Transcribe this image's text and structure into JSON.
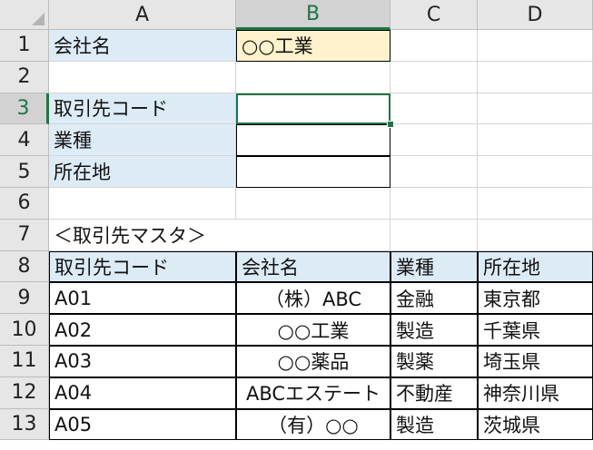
{
  "columns": [
    "A",
    "B",
    "C",
    "D"
  ],
  "selected_column": "B",
  "rows": [
    "1",
    "2",
    "3",
    "4",
    "5",
    "6",
    "7",
    "8",
    "9",
    "10",
    "11",
    "12",
    "13"
  ],
  "selected_row": "3",
  "cells": {
    "A1": "会社名",
    "B1": "○○工業",
    "A3": "取引先コード",
    "A4": "業種",
    "A5": "所在地",
    "A7": "＜取引先マスタ＞",
    "A8": "取引先コード",
    "B8": "会社名",
    "C8": "業種",
    "D8": "所在地",
    "A9": "A01",
    "B9": "（株）ABC",
    "C9": "金融",
    "D9": "東京都",
    "A10": "A02",
    "B10": "○○工業",
    "C10": "製造",
    "D10": "千葉県",
    "A11": "A03",
    "B11": "○○薬品",
    "C11": "製薬",
    "D11": "埼玉県",
    "A12": "A04",
    "B12": "ABCエステート",
    "C12": "不動産",
    "D12": "神奈川県",
    "A13": "A05",
    "B13": "（有）○○",
    "C13": "製造",
    "D13": "茨城県"
  },
  "colors": {
    "label_fill": "#ddebf7",
    "input_fill": "#fff2cc",
    "selection": "#217346"
  }
}
